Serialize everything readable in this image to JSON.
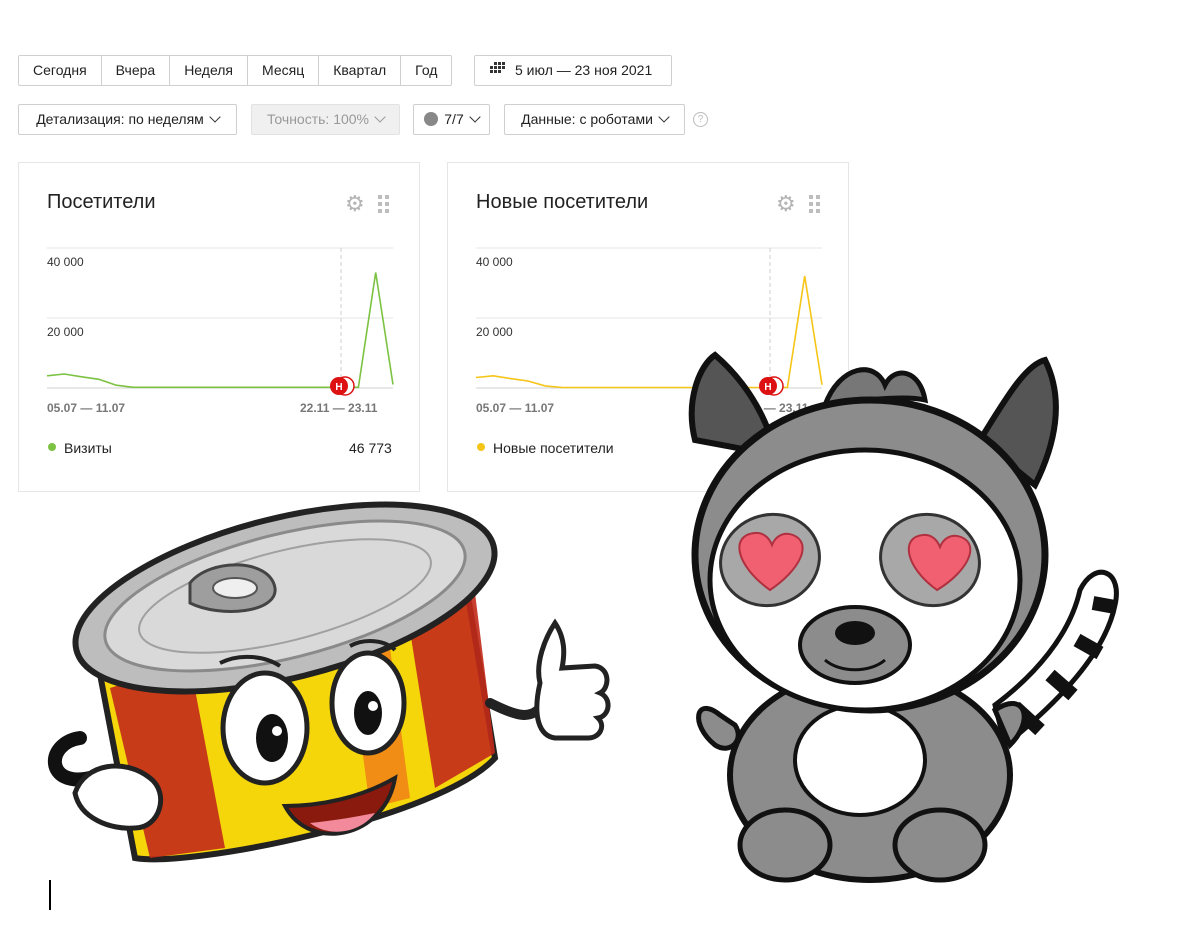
{
  "toolbar": {
    "periods": [
      "Сегодня",
      "Вчера",
      "Неделя",
      "Месяц",
      "Квартал",
      "Год"
    ],
    "date_range": "5 июл — 23 ноя 2021",
    "date_icon": "calendar-grid-icon",
    "detail_label": "Детализация: по неделям",
    "accuracy_label": "Точность: 100%",
    "segments_label": "7/7",
    "data_label": "Данные: с роботами",
    "help_symbol": "?"
  },
  "cards": [
    {
      "title": "Посетители",
      "y_ticks": [
        "40 000",
        "20 000"
      ],
      "x_start": "05.07 — 11.07",
      "x_end": "22.11 — 23.11",
      "legend_label": "Визиты",
      "legend_value": "46 773",
      "color": "#7cc243",
      "annotation": "Н"
    },
    {
      "title": "Новые посетители",
      "y_ticks": [
        "40 000",
        "20 000"
      ],
      "x_start": "05.07 — 11.07",
      "x_end": "22.11 — 23.11",
      "legend_label": "Новые посетители",
      "legend_value": "",
      "color": "#f5c518",
      "annotation": "Н"
    }
  ],
  "chart_data": [
    {
      "type": "line",
      "title": "Посетители",
      "series": [
        {
          "name": "Визиты",
          "values": [
            3500,
            4000,
            3200,
            2500,
            800,
            200,
            200,
            200,
            200,
            200,
            200,
            200,
            200,
            200,
            200,
            200,
            200,
            200,
            200,
            33000,
            1000
          ]
        }
      ],
      "ylim": [
        0,
        40000
      ],
      "y_ticks": [
        20000,
        40000
      ],
      "x_labels": [
        "05.07 — 11.07",
        "22.11 — 23.11"
      ],
      "grid": true
    },
    {
      "type": "line",
      "title": "Новые посетители",
      "series": [
        {
          "name": "Новые посетители",
          "values": [
            3000,
            3500,
            2700,
            2000,
            600,
            150,
            150,
            150,
            150,
            150,
            150,
            150,
            150,
            150,
            150,
            150,
            150,
            150,
            150,
            32000,
            900
          ]
        }
      ],
      "ylim": [
        0,
        40000
      ],
      "y_ticks": [
        20000,
        40000
      ],
      "x_labels": [
        "05.07 — 11.07",
        "22.11 — 23.11"
      ],
      "grid": true
    }
  ],
  "stickers": {
    "can": "cartoon-tin-can-thumbs-up",
    "lemur": "cartoon-lemur-heart-eyes"
  }
}
